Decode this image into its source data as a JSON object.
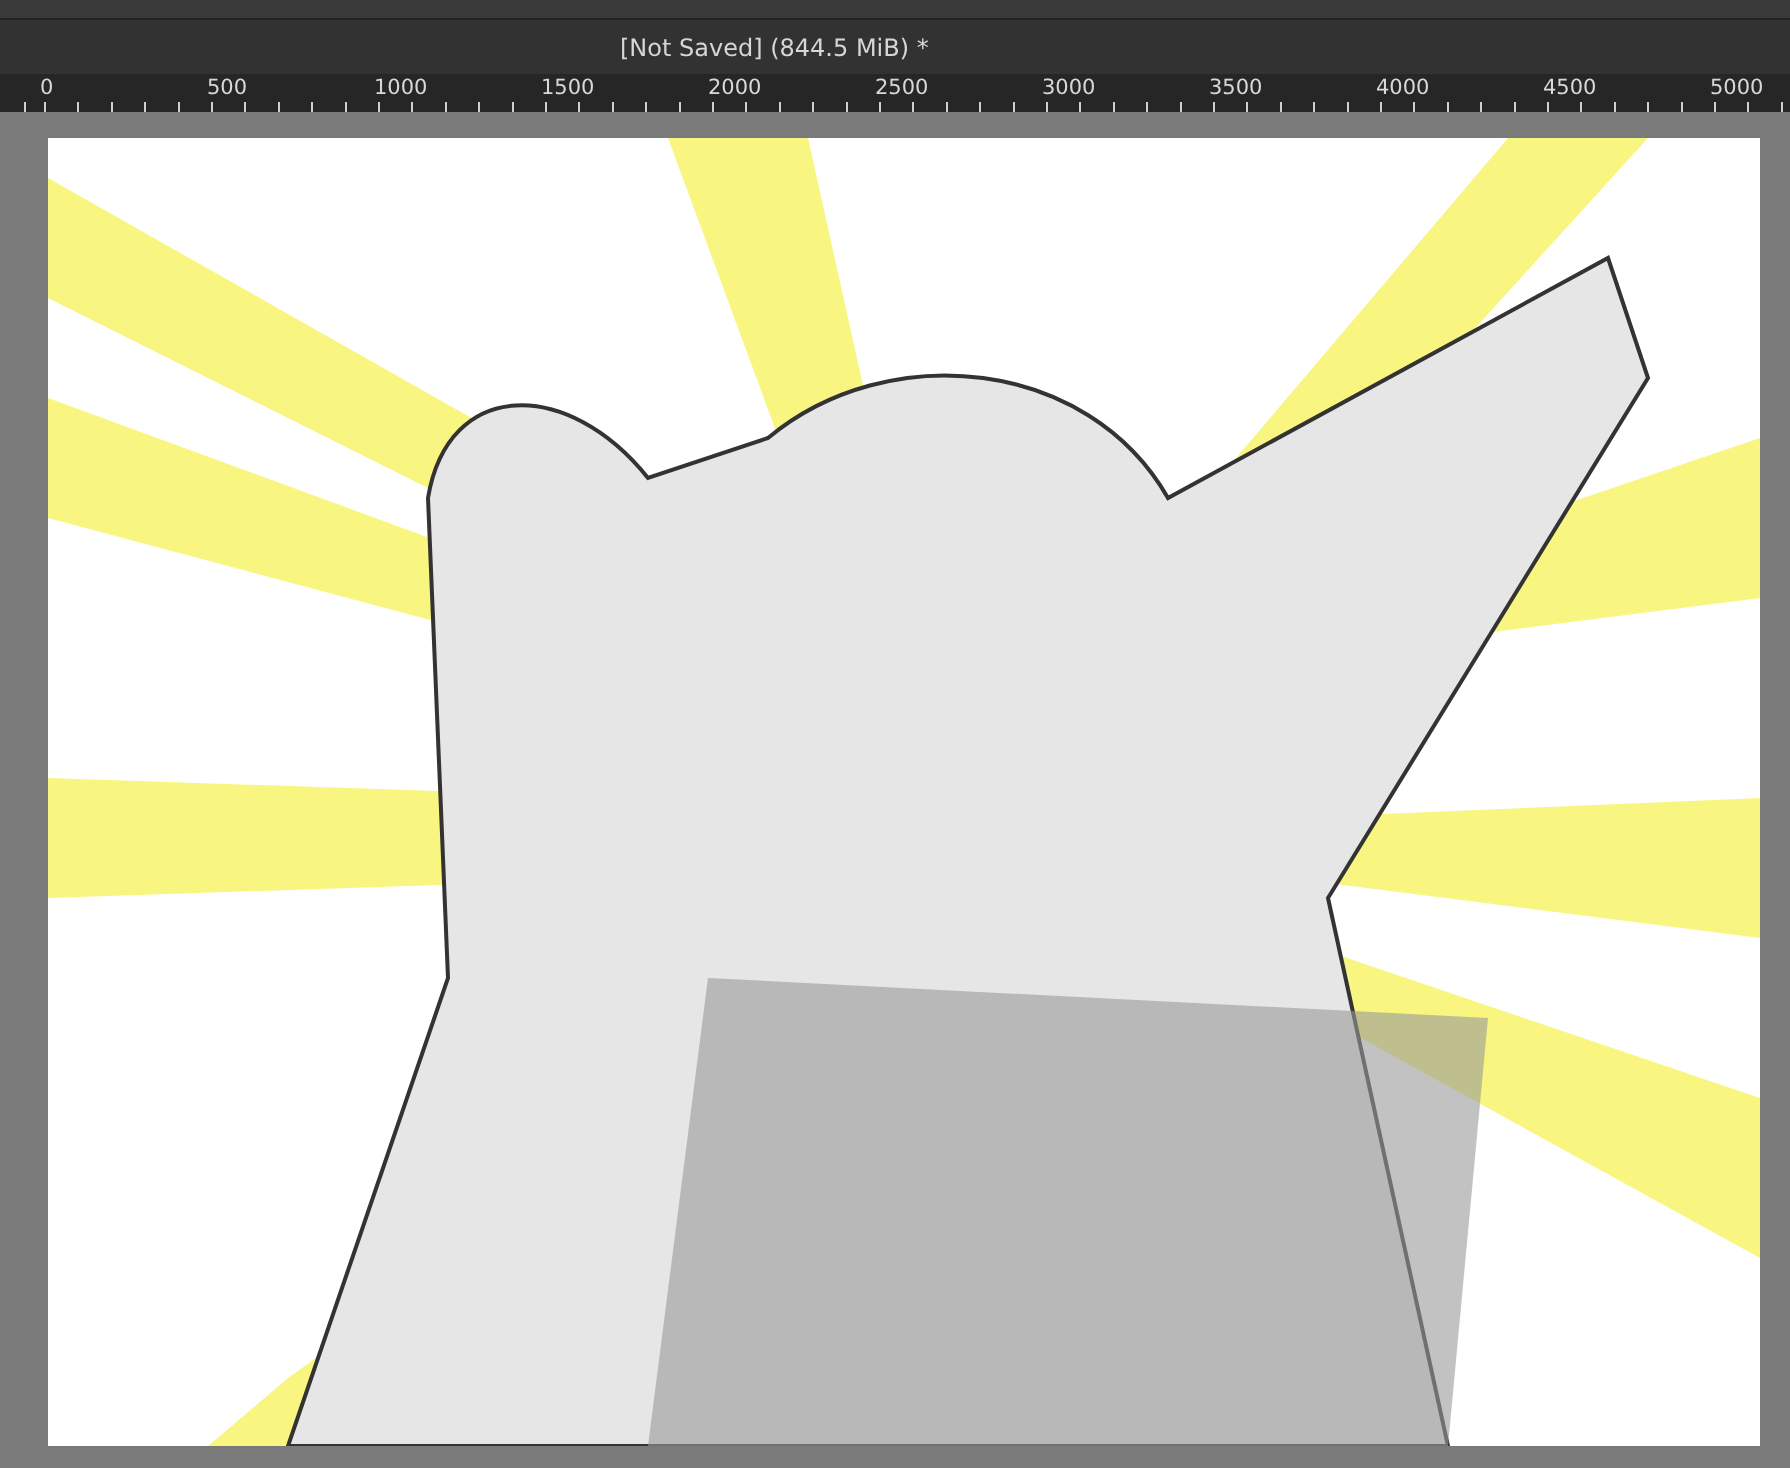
{
  "window": {
    "title": "[Not Saved]  (844.5 MiB) *"
  },
  "ruler": {
    "labels": [
      "0",
      "500",
      "1000",
      "1500",
      "2000",
      "2500",
      "3000",
      "3500",
      "4000",
      "4500",
      "5000"
    ]
  }
}
